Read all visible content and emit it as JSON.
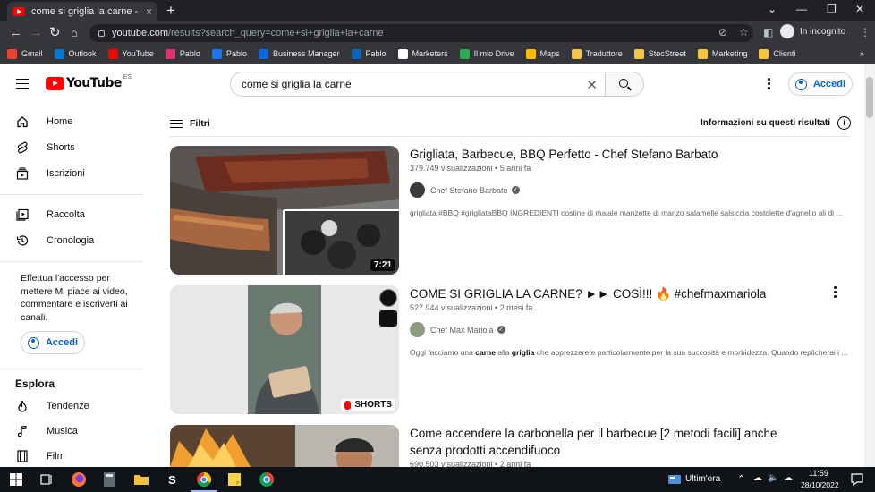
{
  "browser": {
    "tab_title": "come si griglia la carne - YouTube",
    "tab_close": "×",
    "new_tab": "+",
    "url_host": "youtube.com",
    "url_path": "/results?search_query=come+si+griglia+la+carne",
    "incognito_label": "In incognito",
    "bookmarks": [
      {
        "label": "Gmail",
        "color": "#ea4335"
      },
      {
        "label": "Outlook",
        "color": "#0078d4"
      },
      {
        "label": "YouTube",
        "color": "#ff0000"
      },
      {
        "label": "Pablo",
        "color": "#e1306c"
      },
      {
        "label": "Pablo",
        "color": "#1877f2"
      },
      {
        "label": "Business Manager",
        "color": "#0668e1"
      },
      {
        "label": "Pablo",
        "color": "#0a66c2"
      },
      {
        "label": "Marketers",
        "color": "#ffffff"
      },
      {
        "label": "Il mio Drive",
        "color": "#34a853"
      },
      {
        "label": "Maps",
        "color": "#fbbc04"
      },
      {
        "label": "Traduttore",
        "color": "#f5c542"
      },
      {
        "label": "StocStreet",
        "color": "#f5c542"
      },
      {
        "label": "Marketing",
        "color": "#f5c542"
      },
      {
        "label": "Clienti",
        "color": "#f5c542"
      }
    ],
    "bookmarks_more": "»"
  },
  "header": {
    "logo_text": "YouTube",
    "country_code": "ES",
    "search_value": "come si griglia la carne",
    "signin_label": "Accedi"
  },
  "sidebar": {
    "items": [
      {
        "label": "Home",
        "icon": "home-icon"
      },
      {
        "label": "Shorts",
        "icon": "shorts-icon"
      },
      {
        "label": "Iscrizioni",
        "icon": "subscriptions-icon"
      },
      {
        "label": "Raccolta",
        "icon": "library-icon"
      },
      {
        "label": "Cronologia",
        "icon": "history-icon"
      }
    ],
    "signin_prompt": "Effettua l'accesso per mettere Mi piace ai video, commentare e iscriverti ai canali.",
    "signin_label": "Accedi",
    "explore_heading": "Esplora",
    "explore_items": [
      {
        "label": "Tendenze",
        "icon": "trending-icon"
      },
      {
        "label": "Musica",
        "icon": "music-icon"
      },
      {
        "label": "Film",
        "icon": "film-icon"
      }
    ]
  },
  "main": {
    "filters_label": "Filtri",
    "info_label": "Informazioni su questi risultati",
    "results": [
      {
        "title": "Grigliata, Barbecue, BBQ Perfetto - Chef Stefano Barbato",
        "meta": "379.749 visualizzazioni • 5 anni fa",
        "channel": "Chef Stefano Barbato",
        "description": "grigliata #BBQ #grigliataBBQ INGREDIENTI costine di maiale manzette di manzo salamelle salsiccia costolette d'agnello ali di ...",
        "duration": "7:21"
      },
      {
        "title": "COME SI GRIGLIA LA CARNE? ►► COSÌ!!! 🔥 #chefmaxmariola",
        "meta": "527.944 visualizzazioni • 2 mesi fa",
        "channel": "Chef Max Mariola",
        "description_before": "Oggi facciamo una ",
        "description_b1": "carne",
        "description_mid": " alla ",
        "description_b2": "griglia",
        "description_after": " che apprezzerete particolarmente per la sua succosità e morbidezza. Quando replicherai i ...",
        "badge": "SHORTS"
      },
      {
        "title": "Come accendere la carbonella per il barbecue [2 metodi facili] anche senza prodotti accendifuoco",
        "meta": "690.503 visualizzazioni • 2 anni fa"
      }
    ]
  },
  "taskbar": {
    "news_label": "Ultim'ora",
    "time": "11:59",
    "date": "28/10/2022"
  }
}
